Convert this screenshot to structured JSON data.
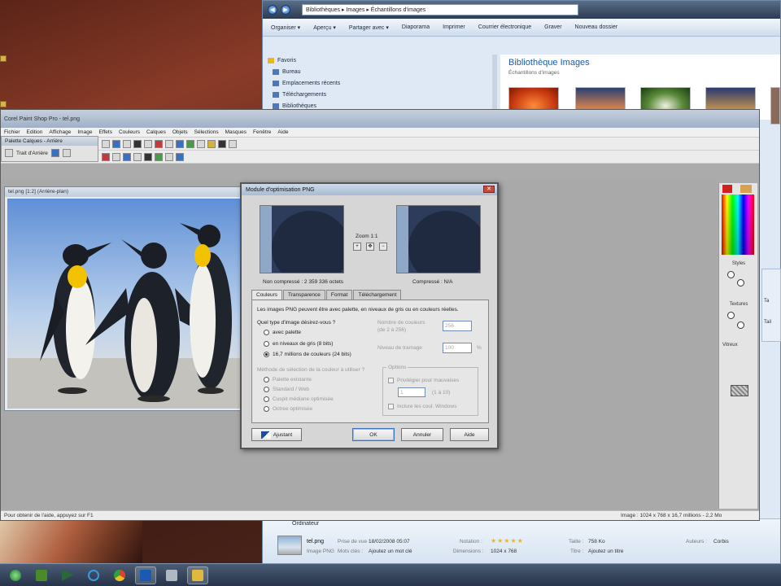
{
  "explorer": {
    "address": "Bibliothèques ▸ Images ▸ Échantillons d'images",
    "toolbar": [
      "Organiser ▾",
      "Aperçu ▾",
      "Partager avec ▾",
      "Diaporama",
      "Imprimer",
      "Courrier électronique",
      "Graver",
      "Nouveau dossier"
    ],
    "nav": [
      "Favoris",
      "Bureau",
      "Emplacements récents",
      "Téléchargements",
      "Bibliothèques"
    ],
    "library_title": "Bibliothèque Images",
    "library_subtitle": "Échantillons d'images",
    "details": {
      "header": "Ordinateur",
      "filename": "tel.png",
      "type": "Image PNG",
      "date_label": "Prise de vue :",
      "date_value": "18/02/2008 05:07",
      "tags_label": "Mots clés :",
      "tags_value": "Ajoutez un mot clé",
      "rating_label": "Notation :",
      "rating_stars": "★★★★★",
      "dims_label": "Dimensions :",
      "dims_value": "1024 x 768",
      "size_label": "Taille :",
      "size_value": "758 Ko",
      "title_label": "Titre :",
      "title_value": "Ajoutez un titre",
      "authors_label": "Auteurs :",
      "authors_value": "Corbis"
    }
  },
  "psp": {
    "title": "Corel Paint Shop Pro - tel.png",
    "menu": [
      "Fichier",
      "Edition",
      "Affichage",
      "Image",
      "Effets",
      "Couleurs",
      "Calques",
      "Objets",
      "Sélections",
      "Masques",
      "Fenêtre",
      "Aide"
    ],
    "palette_title": "Palette Calques - Arrière",
    "palette_layer": "Trait d'Arrière",
    "image_window_title": "tel.png [1:2] (Arrière-plan)",
    "right_palette": {
      "styles_label": "Styles",
      "textures_label": "Textures",
      "transparent_label": "Vitreux"
    },
    "status_left": "Pour obtenir de l'aide, appuyez sur F1",
    "status_right": "Image : 1024 x 768 x 16,7 millions - 2,2 Mo"
  },
  "side_strip": [
    "Ta",
    "Tail"
  ],
  "dialog": {
    "title": "Module d'optimisation PNG",
    "close": "✕",
    "zoom_label": "Zoom 1:1",
    "left_caption": "Non compressé : 2 359 336 octets",
    "right_caption": "Compressé : N/A",
    "tabs": [
      "Couleurs",
      "Transparence",
      "Format",
      "Téléchargement"
    ],
    "description": "Les images PNG peuvent être avec palette, en niveaux de gris ou en couleurs réelles.",
    "question": "Quel type d'image désirez-vous ?",
    "options": [
      "avec palette",
      "en niveaux de gris (8 bits)",
      "16,7 millions de couleurs (24 bits)"
    ],
    "selected_option": 2,
    "num_colors_label": "Nombre de couleurs",
    "num_colors_range": "(de 2 à 256)",
    "num_colors_value": "256",
    "dither_label": "Niveau de tramage",
    "dither_value": "100",
    "dither_unit": "%",
    "method_label": "Méthode de sélection de la couleur à utiliser ?",
    "methods": [
      "Palette existante",
      "Standard / Web",
      "Cuspit médiane optimisée",
      "Octree optimisée"
    ],
    "options_label": "Options",
    "opt_check1": "Privilégier pour mauvaises",
    "opt_check1_value": "1",
    "opt_check1_suffix": "(1 à 10)",
    "opt_check2": "Inclure les coul. Windows",
    "help_btn": "Ajustant",
    "ok_btn": "OK",
    "cancel_btn": "Annuler",
    "aide_btn": "Aide"
  },
  "colors": {
    "accent": "#3a6fbf",
    "explorer_title": "#2c3c52",
    "workspace": "#a9a9a9",
    "library_title": "#1e5ba8"
  }
}
